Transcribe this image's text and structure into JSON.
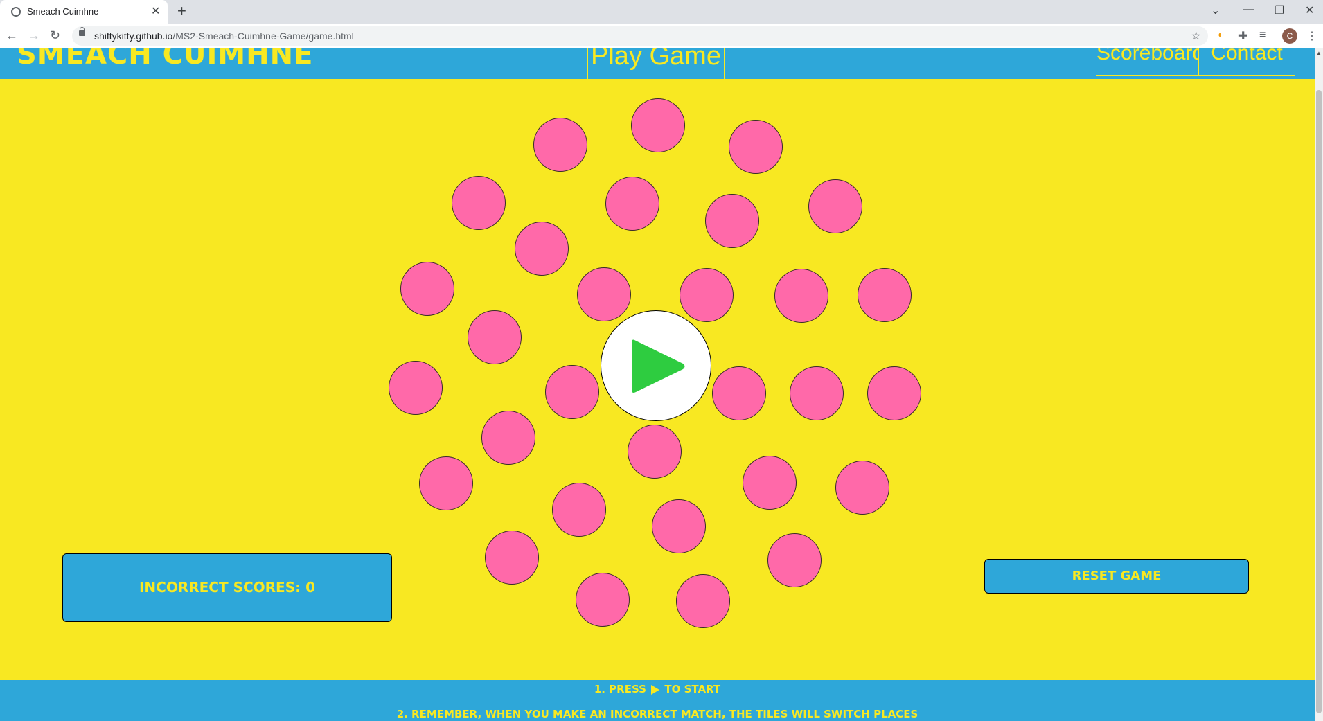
{
  "browser": {
    "tab_title": "Smeach Cuimhne",
    "url_host": "shiftykitty.github.io",
    "url_path": "/MS2-Smeach-Cuimhne-Game/game.html",
    "profile_initial": "C"
  },
  "header": {
    "logo": "SMEACH CUIMHNE",
    "nav": {
      "play": "Play Game",
      "scoreboard": "Scoreboard",
      "contact": "Contact Us"
    }
  },
  "game": {
    "tile_color": "#ff69a9",
    "tile_count": 32,
    "play_icon_color": "#2ecc40"
  },
  "score": {
    "label": "INCORRECT SCORES: 0"
  },
  "controls": {
    "reset_label": "RESET GAME"
  },
  "footer": {
    "step1_prefix": "1. PRESS",
    "step1_suffix": "TO START",
    "step2": "2. REMEMBER, WHEN YOU MAKE AN INCORRECT MATCH, THE TILES WILL SWITCH PLACES"
  },
  "colors": {
    "background": "#f8e822",
    "header": "#2ea7d9"
  }
}
